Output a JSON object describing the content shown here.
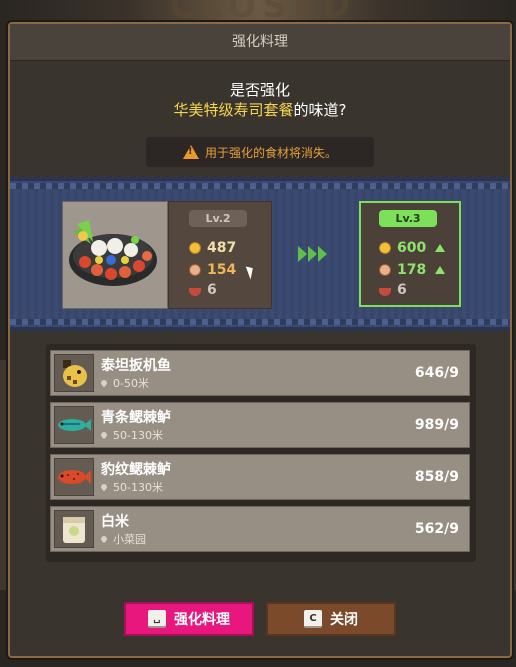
{
  "background": {
    "sign_text": "CLOSED"
  },
  "dialog": {
    "title": "强化料理",
    "question_line1": "是否强化",
    "dish_name": "华美特级寿司套餐",
    "question_tail": "的味道?",
    "warning": "用于强化的食材将消失。"
  },
  "current": {
    "level": "Lv.2",
    "price": "487",
    "taste": "154",
    "servings": "6"
  },
  "next": {
    "level": "Lv.3",
    "price": "600",
    "taste": "178",
    "servings": "6"
  },
  "ingredients": [
    {
      "name": "泰坦扳机鱼",
      "location": "0-50米",
      "count": "646/9",
      "icon": "titan-triggerfish-icon"
    },
    {
      "name": "青条鳃棘鲈",
      "location": "50-130米",
      "count": "989/9",
      "icon": "green-coral-grouper-icon"
    },
    {
      "name": "豹纹鳃棘鲈",
      "location": "50-130米",
      "count": "858/9",
      "icon": "leopard-coral-grouper-icon"
    },
    {
      "name": "白米",
      "location": "小菜园",
      "count": "562/9",
      "icon": "rice-icon"
    }
  ],
  "buttons": {
    "confirm_label": "强化料理",
    "confirm_key": "␣",
    "close_label": "关闭",
    "close_key": "C"
  },
  "colors": {
    "accent_pink": "#e8177e",
    "level_green": "#7de05b",
    "dish_yellow": "#f3d54e",
    "warning_orange": "#e6a03a"
  }
}
